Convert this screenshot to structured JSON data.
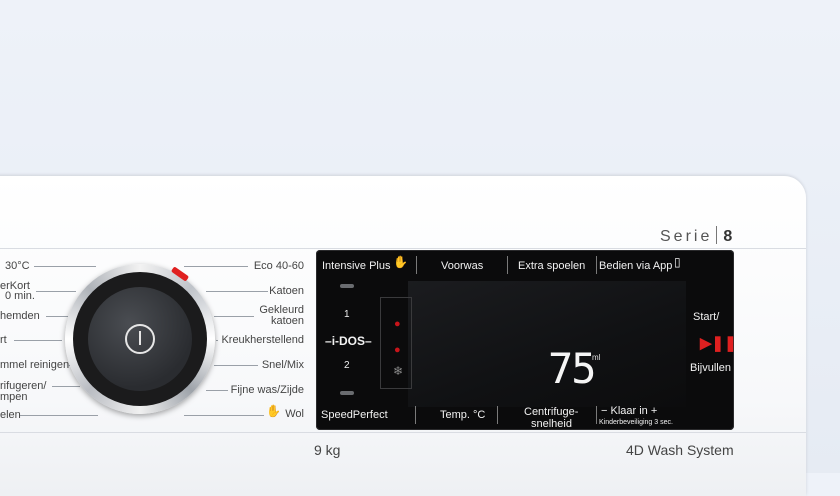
{
  "branding": {
    "serie_word": "Serie",
    "serie_number": "8",
    "capacity": "9 kg",
    "system": "4D Wash System"
  },
  "programs_left": [
    "30°C",
    "erKort",
    "0 min.",
    "hemden",
    "rt",
    "mmel reinigen",
    "rifugeren/",
    "mpen",
    "elen"
  ],
  "programs_right": [
    "Eco 40-60",
    "Katoen",
    "Gekleurd",
    "katoen",
    "Kreukherstellend",
    "Snel/Mix",
    "Fijne was/Zijde",
    "Wol"
  ],
  "top_buttons": [
    "Intensive Plus",
    "Voorwas",
    "Extra spoelen",
    "Bedien via App"
  ],
  "idos": {
    "label": "i-DOS",
    "slot1": "1",
    "slot2": "2"
  },
  "bottom_buttons": [
    "SpeedPerfect",
    "Temp. °C",
    "Centrifuge-",
    "snelheid",
    "− Klaar in +",
    "Kinderbeveiliging 3 sec."
  ],
  "start": {
    "line1": "Start/",
    "line2": "Bijvullen"
  },
  "display": {
    "value": "75",
    "unit": "ml"
  },
  "colors": {
    "accent": "#e02020",
    "panel": "#0b0b0c"
  },
  "icons": [
    "hand-icon",
    "app-icon",
    "drop-icon",
    "snowflake-icon",
    "play-pause-icon",
    "power-icon"
  ]
}
